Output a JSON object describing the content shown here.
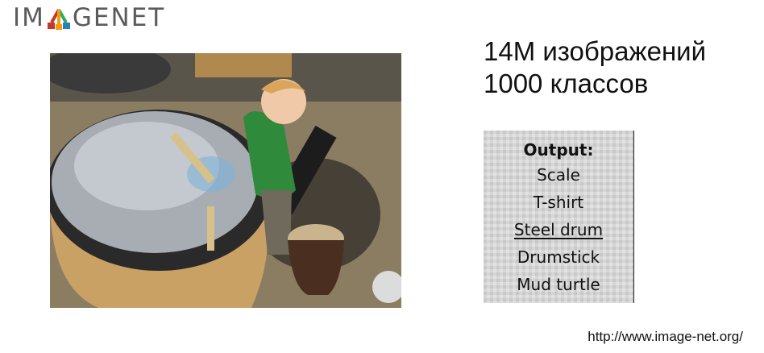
{
  "logo": {
    "text_left": "IM",
    "text_right": "GENET"
  },
  "headline": {
    "line1": "14M изображений",
    "line2": "1000 классов"
  },
  "output": {
    "title": "Output:",
    "items": [
      "Scale",
      "T-shirt",
      "Steel drum",
      "Drumstick",
      "Mud turtle"
    ]
  },
  "footer": {
    "url": "http://www.image-net.org/"
  },
  "colors": {
    "logo_gray": "#5b5b5b",
    "logo_red": "#c0392b",
    "logo_orange": "#f39c12",
    "logo_green": "#27ae60",
    "logo_blue": "#2980b9"
  }
}
